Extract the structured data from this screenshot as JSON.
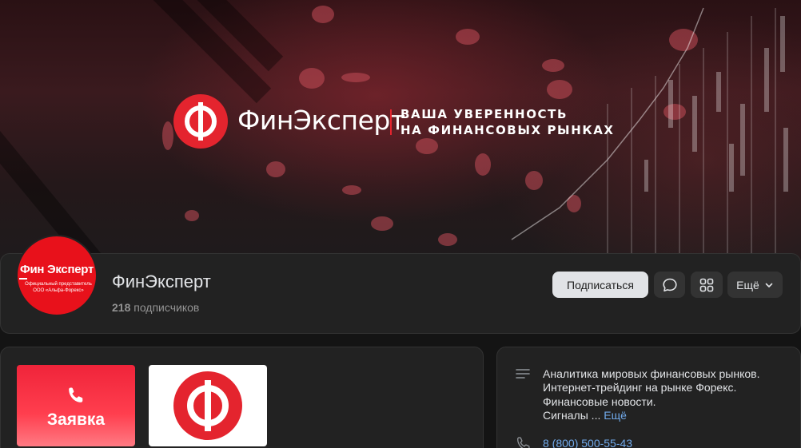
{
  "cover": {
    "brand": "ФинЭксперт",
    "tagline_line1": "ВАША УВЕРЕННОСТЬ",
    "tagline_line2": "НА ФИНАНСОВЫХ РЫНКАХ",
    "logo_icon": "ruble-f-logo-icon"
  },
  "avatar": {
    "name": "Фин Эксперт",
    "subtitle": "Официальный представитель ООО «Альфа-Форекс»"
  },
  "profile": {
    "name": "ФинЭксперт",
    "subscribers_count": "218",
    "subscribers_label": "подписчиков"
  },
  "actions": {
    "subscribe_label": "Подписаться",
    "message_icon": "message-bubble-icon",
    "apps_icon": "apps-grid-icon",
    "more_label": "Ещё",
    "more_icon": "chevron-down-icon"
  },
  "tiles": {
    "request_label": "Заявка",
    "request_icon": "phone-icon"
  },
  "info": {
    "description_line1": "Аналитика мировых финансовых рынков.",
    "description_line2": "Интернет-трейдинг на рынке Форекс.",
    "description_line3": "Финансовые новости.",
    "description_line4": "Сигналы ...",
    "more_link": "Ещё",
    "phone": "8 (800) 500-55-43"
  },
  "colors": {
    "accent_red": "#e4242e",
    "link_blue": "#71aaeb",
    "card_bg": "#222222",
    "page_bg": "#141414"
  }
}
